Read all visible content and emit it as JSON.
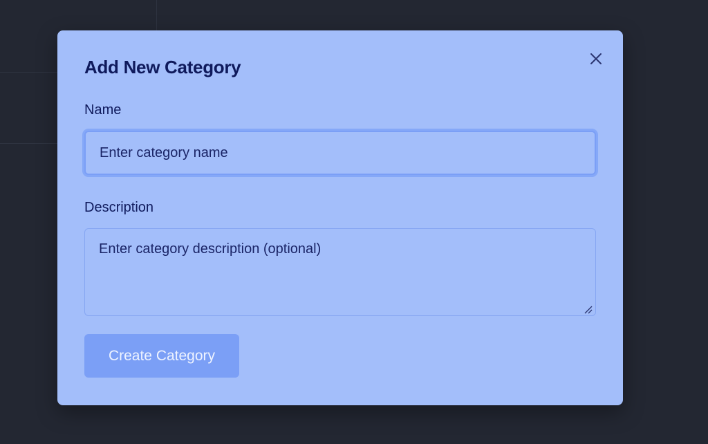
{
  "modal": {
    "title": "Add New Category",
    "close_icon": "close-icon",
    "name_field": {
      "label": "Name",
      "value": "",
      "placeholder": "Enter category name"
    },
    "description_field": {
      "label": "Description",
      "value": "",
      "placeholder": "Enter category description (optional)"
    },
    "submit_label": "Create Category"
  },
  "colors": {
    "backdrop": "#232732",
    "modal_bg": "#a3befa",
    "text": "#0f1a5c",
    "accent": "#7b9ff6"
  }
}
